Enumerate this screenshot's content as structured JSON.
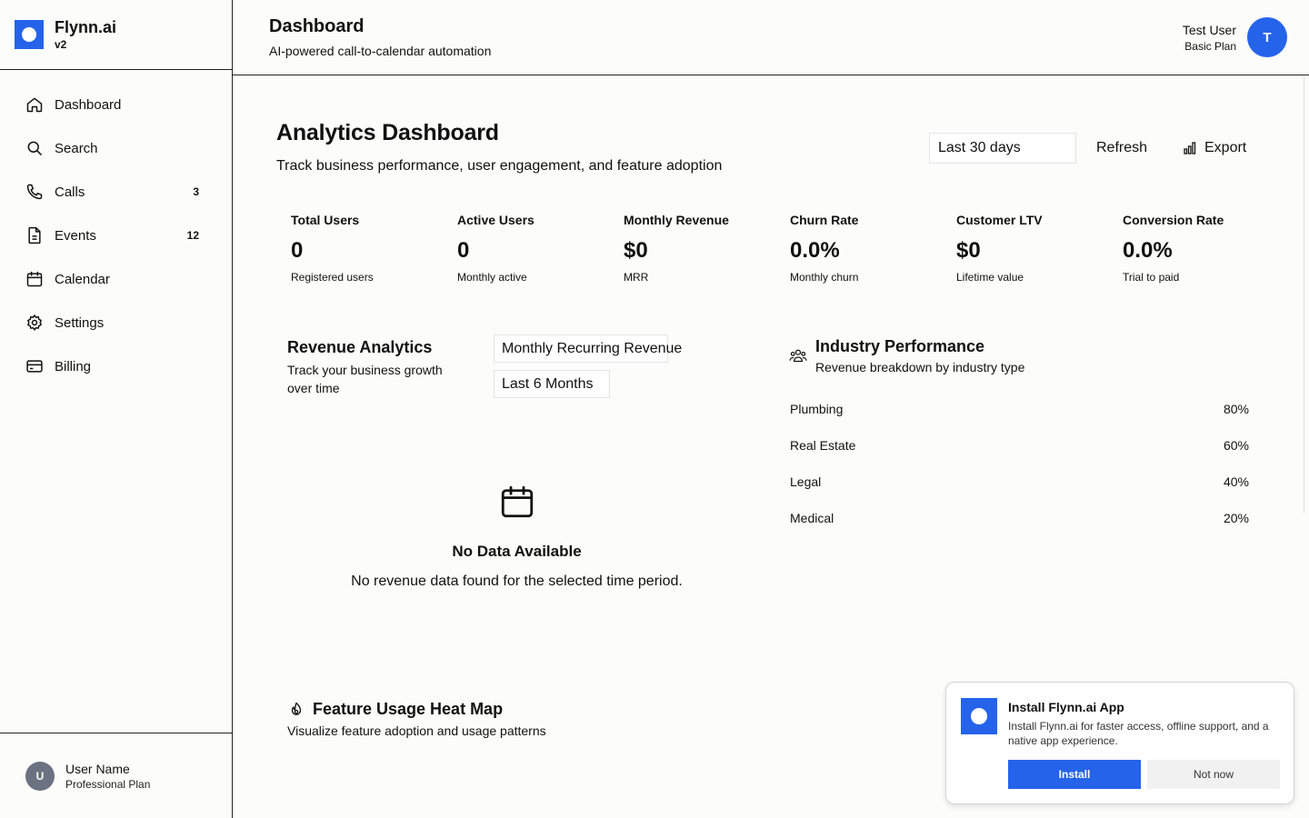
{
  "app": {
    "name": "Flynn.ai",
    "version": "v2",
    "accent": "#2563eb"
  },
  "sidebar": {
    "items": [
      {
        "label": "Dashboard",
        "icon": "home-icon",
        "badge": ""
      },
      {
        "label": "Search",
        "icon": "search-icon",
        "badge": ""
      },
      {
        "label": "Calls",
        "icon": "phone-icon",
        "badge": "3"
      },
      {
        "label": "Events",
        "icon": "document-icon",
        "badge": "12"
      },
      {
        "label": "Calendar",
        "icon": "calendar-icon",
        "badge": ""
      },
      {
        "label": "Settings",
        "icon": "gear-icon",
        "badge": ""
      },
      {
        "label": "Billing",
        "icon": "credit-card-icon",
        "badge": ""
      }
    ],
    "footer": {
      "avatar": "U",
      "name": "User Name",
      "plan": "Professional Plan"
    }
  },
  "header": {
    "title": "Dashboard",
    "subtitle": "AI-powered call-to-calendar automation",
    "user": {
      "name": "Test User",
      "plan": "Basic Plan",
      "avatar": "T"
    }
  },
  "analytics": {
    "title": "Analytics Dashboard",
    "subtitle": "Track business performance, user engagement, and feature adoption",
    "range": "Last 30 days",
    "refresh_label": "Refresh",
    "export_label": "Export",
    "metrics": [
      {
        "label": "Total Users",
        "value": "0",
        "desc": "Registered users"
      },
      {
        "label": "Active Users",
        "value": "0",
        "desc": "Monthly active"
      },
      {
        "label": "Monthly Revenue",
        "value": "$0",
        "desc": "MRR"
      },
      {
        "label": "Churn Rate",
        "value": "0.0%",
        "desc": "Monthly churn"
      },
      {
        "label": "Customer LTV",
        "value": "$0",
        "desc": "Lifetime value"
      },
      {
        "label": "Conversion Rate",
        "value": "0.0%",
        "desc": "Trial to paid"
      }
    ]
  },
  "revenue": {
    "title": "Revenue Analytics",
    "subtitle": "Track your business growth over time",
    "metric_select": "Monthly Recurring Revenue",
    "period_select": "Last 6 Months",
    "empty_title": "No Data Available",
    "empty_text": "No revenue data found for the selected time period."
  },
  "industry": {
    "title": "Industry Performance",
    "subtitle": "Revenue breakdown by industry type",
    "rows": [
      {
        "name": "Plumbing",
        "pct": "80%"
      },
      {
        "name": "Real Estate",
        "pct": "60%"
      },
      {
        "name": "Legal",
        "pct": "40%"
      },
      {
        "name": "Medical",
        "pct": "20%"
      }
    ]
  },
  "heatmap": {
    "title": "Feature Usage Heat Map",
    "subtitle": "Visualize feature adoption and usage patterns"
  },
  "install_toast": {
    "title": "Install Flynn.ai App",
    "body": "Install Flynn.ai for faster access, offline support, and a native app experience.",
    "install_label": "Install",
    "dismiss_label": "Not now"
  }
}
